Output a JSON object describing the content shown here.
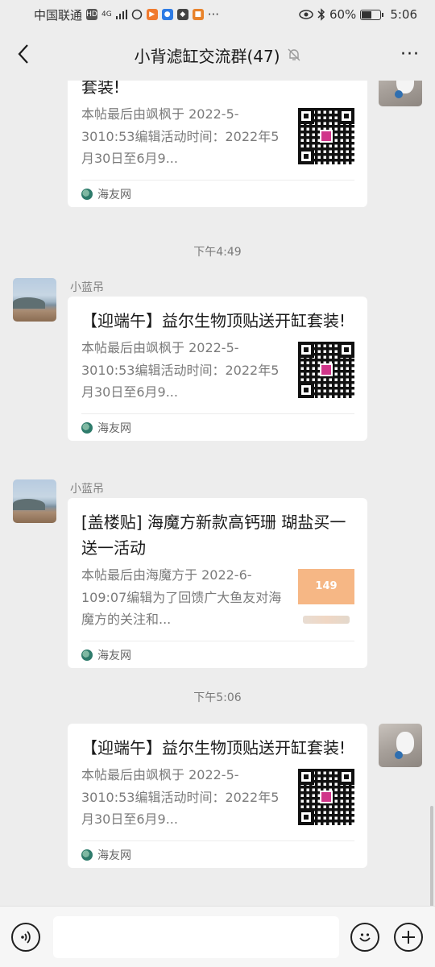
{
  "status_bar": {
    "carrier": "中国联通",
    "network_badges": [
      "HD",
      "4G"
    ],
    "battery": "60%",
    "battery_level": 0.6,
    "time": "5:06",
    "more": "···"
  },
  "header": {
    "title": "小背滤缸交流群(47)",
    "more": "···"
  },
  "chat": {
    "top_card": {
      "title_partial": "套装!",
      "description": "本帖最后由飒枫于 2022-5-3010:53编辑活动时间：2022年5月30日至6月9...",
      "source": "海友网"
    },
    "time_1": "下午4:49",
    "messages": [
      {
        "sender": "小蓝吊",
        "title": "【迎端午】益尔生物顶贴送开缸套装!",
        "description": "本帖最后由飒枫于 2022-5-3010:53编辑活动时间：2022年5月30日至6月9...",
        "source": "海友网"
      },
      {
        "sender": "小蓝吊",
        "title": "[盖楼贴] 海魔方新款高钙珊 瑚盐买一送一活动",
        "description": "本帖最后由海魔方于 2022-6-109:07编辑为了回馈广大鱼友对海魔方的关注和...",
        "source": "海友网"
      }
    ],
    "time_2": "下午5:06",
    "own_message": {
      "title": "【迎端午】益尔生物顶贴送开缸套装!",
      "description": "本帖最后由飒枫于 2022-5-3010:53编辑活动时间：2022年5月30日至6月9...",
      "source": "海友网"
    }
  },
  "icons": {
    "back": "chevron-left-icon",
    "mute": "bell-off-icon",
    "voice": "voice-icon",
    "emoji": "emoji-icon",
    "add": "plus-circle-icon"
  }
}
